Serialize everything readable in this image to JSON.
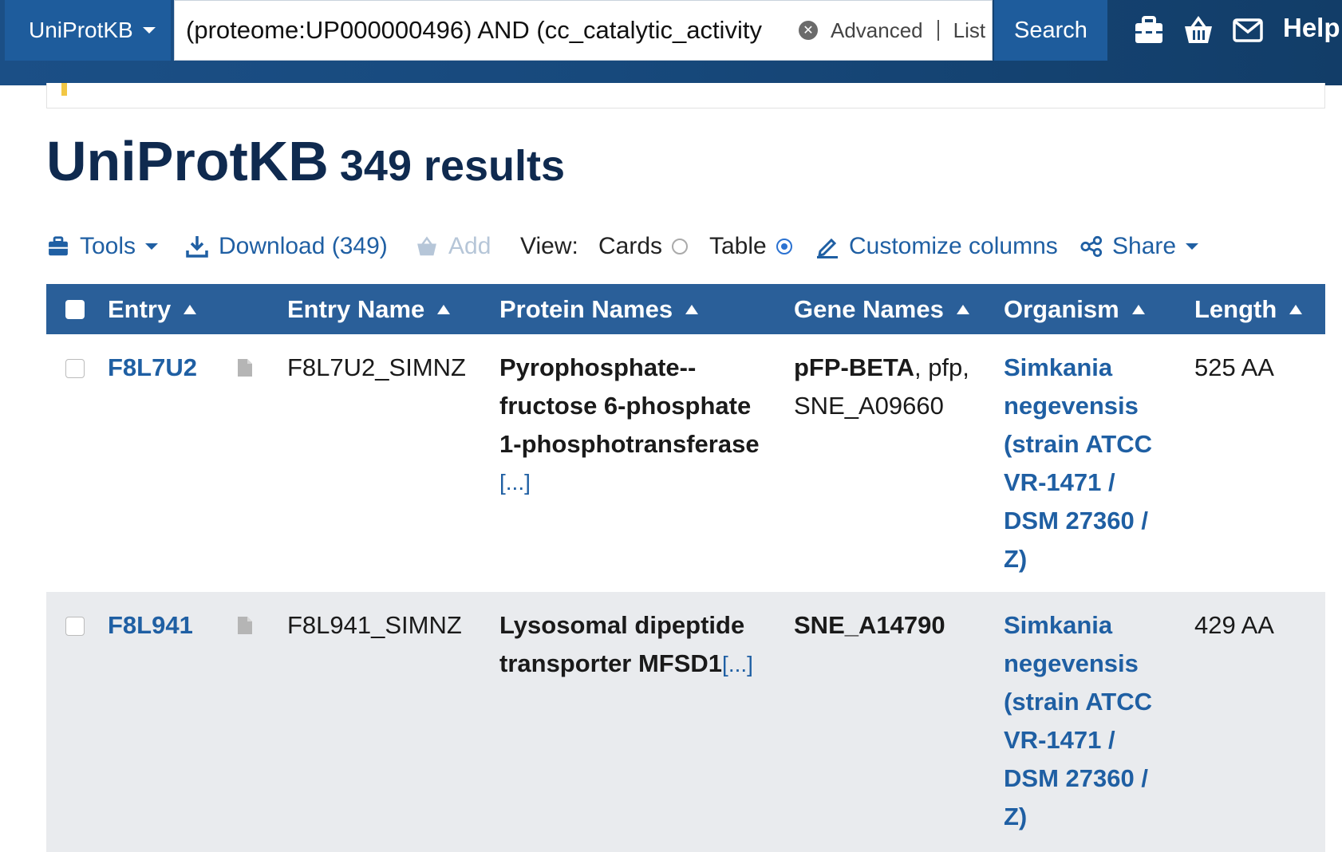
{
  "header": {
    "db_selector": "UniProtKB",
    "query": "(proteome:UP000000496) AND (cc_catalytic_activity",
    "advanced_label": "Advanced",
    "list_label": "List",
    "search_label": "Search",
    "help_label": "Help",
    "icons": [
      "toolbox-icon",
      "basket-icon",
      "mail-icon"
    ]
  },
  "title": {
    "db": "UniProtKB",
    "results": "349 results"
  },
  "toolbar": {
    "tools_label": "Tools",
    "download_label": "Download (349)",
    "add_label": "Add",
    "view_label": "View:",
    "cards_label": "Cards",
    "table_label": "Table",
    "view_selected": "Table",
    "customize_label": "Customize columns",
    "share_label": "Share"
  },
  "table": {
    "columns": [
      "Entry",
      "Entry Name",
      "Protein Names",
      "Gene Names",
      "Organism",
      "Length"
    ],
    "rows": [
      {
        "entry": "F8L7U2",
        "entry_name": "F8L7U2_SIMNZ",
        "protein_lines": [
          "Pyrophosphate--",
          "fructose 6-phosphate",
          "1-phosphotransferase"
        ],
        "protein_more": "[...]",
        "gene_primary": "pFP-BETA",
        "gene_rest_line1": ", pfp,",
        "gene_line2": "SNE_A09660",
        "organism_lines": [
          "Simkania",
          "negevensis",
          "(strain ATCC",
          "VR-1471 /",
          "DSM 27360 /",
          "Z)"
        ],
        "length": "525 AA"
      },
      {
        "entry": "F8L941",
        "entry_name": "F8L941_SIMNZ",
        "protein_lines": [
          "Lysosomal dipeptide",
          "transporter MFSD1"
        ],
        "protein_more": "[...]",
        "gene_primary": "SNE_A14790",
        "organism_lines": [
          "Simkania",
          "negevensis",
          "(strain ATCC",
          "VR-1471 /",
          "DSM 27360 /",
          "Z)"
        ],
        "length": "429 AA"
      }
    ]
  },
  "colors": {
    "header_bg": "#17497c",
    "accent_button": "#1e5c9c",
    "table_header": "#2a5f99",
    "link": "#1f5fa3",
    "title": "#0f2a4f",
    "alt_row": "#e9ebee"
  }
}
